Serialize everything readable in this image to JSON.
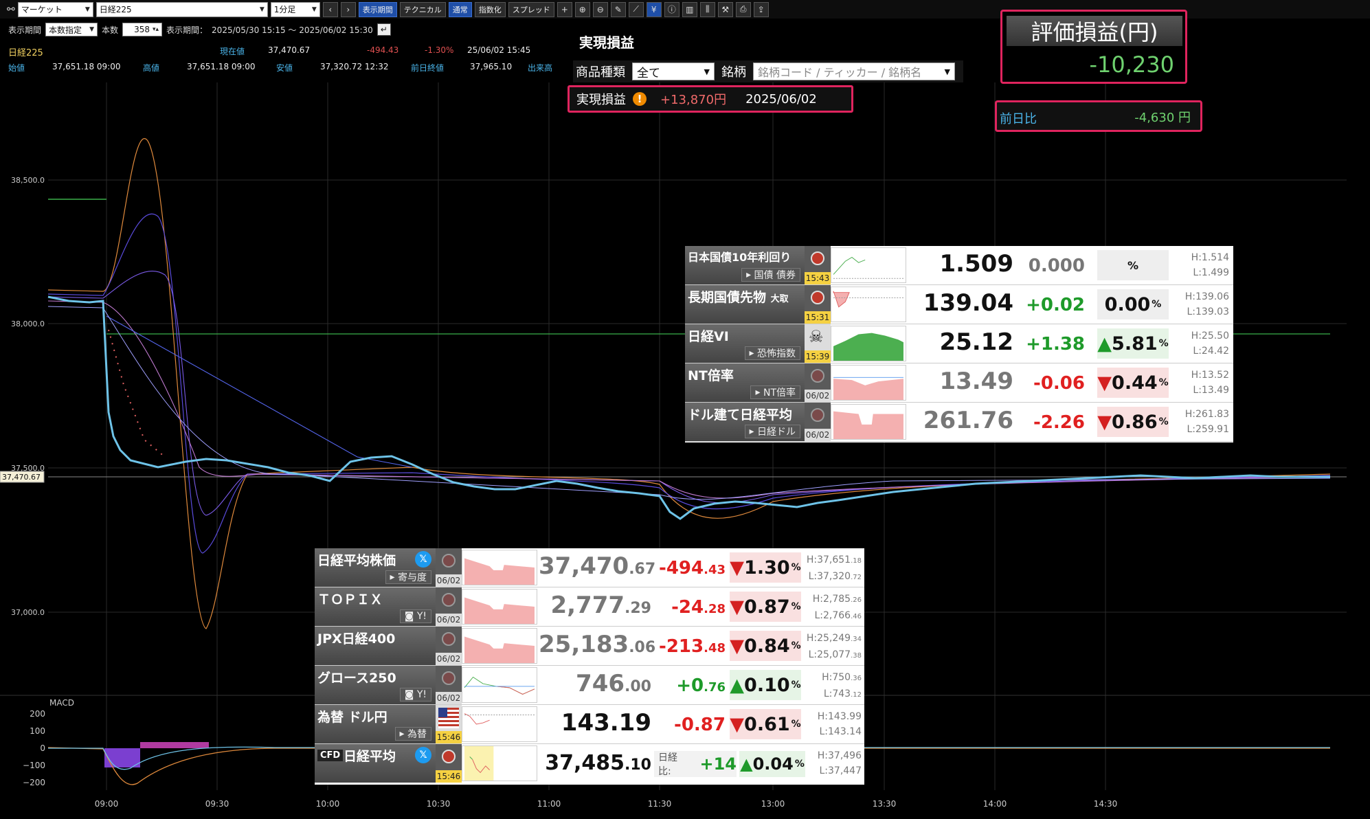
{
  "toolbar": {
    "market_select": "マーケット",
    "symbol_select": "日経225",
    "interval_select": "1分足",
    "period_button": "表示期間",
    "technical_button": "テクニカル",
    "normal_button": "通常",
    "index_button": "指数化",
    "spread_button": "スプレッド"
  },
  "period": {
    "label": "表示期間",
    "mode_select": "本数指定",
    "count_label": "本数",
    "count_value": "358",
    "range_label": "表示期間：",
    "range_value": "2025/05/30 15:15 ～ 2025/06/02 15:30"
  },
  "quote": {
    "symbol": "日経225",
    "current_label": "現在値",
    "current_value": "37,470.67",
    "change": "-494.43",
    "change_pct": "-1.30%",
    "datetime": "25/06/02  15:45",
    "open_label": "始値",
    "open_value": "37,651.18  09:00",
    "high_label": "高値",
    "high_value": "37,651.18  09:00",
    "low_label": "安値",
    "low_value": "37,320.72  12:32",
    "prev_label": "前日終値",
    "prev_value": "37,965.10",
    "volume_label": "出来高"
  },
  "chart_data": {
    "type": "line",
    "title": "",
    "y_ticks": [
      "38,500.0",
      "38,000.0",
      "37,500.0",
      "37,000.0"
    ],
    "x_ticks": [
      "09:00",
      "09:30",
      "10:00",
      "10:30",
      "11:00",
      "11:30",
      "13:00",
      "13:30",
      "14:00",
      "14:30"
    ],
    "last_price_label": "37,470.67",
    "macd_label": "MACD",
    "macd_ticks": [
      "200",
      "100",
      "0",
      "−100",
      "−200"
    ],
    "ylim": [
      36900,
      38700
    ],
    "series": [
      {
        "values": [
          38090,
          38080,
          38070,
          38060,
          38050,
          37950,
          37600,
          37540,
          37510,
          37500,
          37520,
          37530,
          37530,
          37510,
          37500,
          37520,
          37540,
          37530,
          37510,
          37500,
          37490,
          37480,
          37470,
          37460,
          37450,
          37440,
          37420,
          37400,
          37380,
          37360,
          37380,
          37400,
          37410,
          37420,
          37430,
          37440,
          37450,
          37460,
          37470,
          37480,
          37480,
          37490,
          37500,
          37510,
          37500,
          37490,
          37480,
          37480,
          37470,
          37470
        ]
      }
    ]
  },
  "realized": {
    "title": "実現損益",
    "type_label": "商品種類",
    "type_value": "全て",
    "symbol_label": "銘柄",
    "symbol_placeholder": "銘柄コード / ティッカー / 銘柄名",
    "row_label": "実現損益",
    "row_value": "+13,870円",
    "row_date": "2025/06/02"
  },
  "valuation": {
    "title": "評価損益(円)",
    "value": "-10,230",
    "dod_label": "前日比",
    "dod_value": "-4,630 円"
  },
  "bonds": [
    {
      "name": "日本国債10年利回り",
      "sub": "国債 債券",
      "time": "15:43",
      "value": "1.509",
      "change": "0.000",
      "pct": "%",
      "high": "H:1.514",
      "low": "L:1.499"
    },
    {
      "name": "長期国債先物",
      "name_suffix": "大取",
      "sub": "",
      "time": "15:31",
      "value": "139.04",
      "change": "+0.02",
      "pct": "0.00",
      "pct_unit": "%",
      "high": "H:139.06",
      "low": "L:139.03"
    },
    {
      "name": "日経VI",
      "sub": "恐怖指数",
      "time": "15:39",
      "value": "25.12",
      "change": "+1.38",
      "pct": "▲5.81",
      "pct_unit": "%",
      "high": "H:25.50",
      "low": "L:24.42"
    },
    {
      "name": "NT倍率",
      "sub": "NT倍率",
      "time": "06/02",
      "value": "13.49",
      "change": "-0.06",
      "pct": "▼0.44",
      "pct_unit": "%",
      "high": "H:13.52",
      "low": "L:13.49"
    },
    {
      "name": "ドル建て日経平均",
      "sub": "日経ドル",
      "time": "06/02",
      "value": "261.76",
      "change": "-2.26",
      "pct": "▼0.86",
      "pct_unit": "%",
      "high": "H:261.83",
      "low": "L:259.91"
    }
  ],
  "indices": [
    {
      "name": "日経平均株価",
      "sub": "寄与度",
      "time": "06/02",
      "value_int": "37,470",
      "value_dec": ".67",
      "change_int": "-494",
      "change_dec": ".43",
      "pct": "▼1.30",
      "pct_unit": "%",
      "high_int": "H:37,651",
      "high_dec": ".18",
      "low_int": "L:37,320",
      "low_dec": ".72"
    },
    {
      "name": "ＴＯＰＩＸ",
      "sub": "Y!",
      "time": "06/02",
      "value_int": "2,777",
      "value_dec": ".29",
      "change_int": "-24",
      "change_dec": ".28",
      "pct": "▼0.87",
      "pct_unit": "%",
      "high_int": "H:2,785",
      "high_dec": ".26",
      "low_int": "L:2,766",
      "low_dec": ".46"
    },
    {
      "name": "JPX日経400",
      "sub": "",
      "time": "06/02",
      "value_int": "25,183",
      "value_dec": ".06",
      "change_int": "-213",
      "change_dec": ".48",
      "pct": "▼0.84",
      "pct_unit": "%",
      "high_int": "H:25,249",
      "high_dec": ".34",
      "low_int": "L:25,077",
      "low_dec": ".38"
    },
    {
      "name": "グロース250",
      "sub": "Y!",
      "time": "06/02",
      "value_int": "746",
      "value_dec": ".00",
      "change_int": "+0",
      "change_dec": ".76",
      "pct": "▲0.10",
      "pct_unit": "%",
      "high_int": "H:750",
      "high_dec": ".36",
      "low_int": "L:743",
      "low_dec": ".12"
    },
    {
      "name": "為替 ドル円",
      "sub": "為替",
      "time": "15:46",
      "value_int": "143.19",
      "value_dec": "",
      "change_int": "-0.87",
      "change_dec": "",
      "pct": "▼0.61",
      "pct_unit": "%",
      "high_int": "H:143.99",
      "high_dec": "",
      "low_int": "L:143.14",
      "low_dec": ""
    },
    {
      "name": "日経平均",
      "cfd": "CFD",
      "time": "15:46",
      "value_int": "37,485",
      "value_dec": ".10",
      "spread_label": "日経比:",
      "spread_value": "+14",
      "pct": "▲0.04",
      "pct_unit": "%",
      "high_int": "H:37,496",
      "high_dec": "",
      "low_int": "L:37,447",
      "low_dec": ""
    }
  ],
  "colors": {
    "accent": "#e0245e",
    "up": "#1e9a2a",
    "down": "#e02020"
  }
}
